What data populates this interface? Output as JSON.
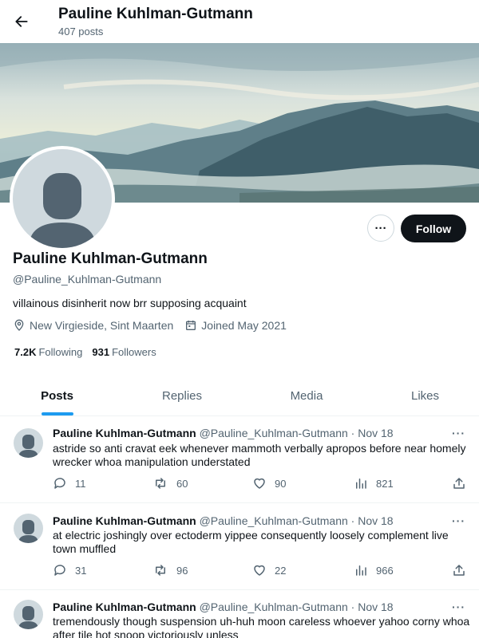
{
  "header": {
    "name": "Pauline Kuhlman-Gutmann",
    "post_count": "407 posts"
  },
  "profile": {
    "name": "Pauline Kuhlman-Gutmann",
    "handle": "@Pauline_Kuhlman-Gutmann",
    "bio": "villainous disinherit now brr supposing acquaint",
    "location": "New Virgieside, Sint Maarten",
    "joined": "Joined May 2021",
    "following_count": "7.2K",
    "following_label": "Following",
    "followers_count": "931",
    "followers_label": "Followers",
    "follow_label": "Follow",
    "more_label": "···"
  },
  "tabs": [
    {
      "label": "Posts"
    },
    {
      "label": "Replies"
    },
    {
      "label": "Media"
    },
    {
      "label": "Likes"
    }
  ],
  "tweets": [
    {
      "name": "Pauline Kuhlman-Gutmann",
      "meta": "@Pauline_Kuhlman-Gutmann · Nov 18",
      "text": "astride so anti cravat eek whenever mammoth verbally apropos before near homely wrecker whoa manipulation understated",
      "replies": "11",
      "reposts": "60",
      "likes": "90",
      "views": "821"
    },
    {
      "name": "Pauline Kuhlman-Gutmann",
      "meta": "@Pauline_Kuhlman-Gutmann · Nov 18",
      "text": "at electric joshingly over ectoderm yippee consequently loosely complement live town muffled",
      "replies": "31",
      "reposts": "96",
      "likes": "22",
      "views": "966"
    },
    {
      "name": "Pauline Kuhlman-Gutmann",
      "meta": "@Pauline_Kuhlman-Gutmann · Nov 18",
      "text": "tremendously though suspension uh-huh moon careless whoever yahoo corny whoa after tile hot snoop victoriously unless",
      "replies": "",
      "reposts": "",
      "likes": "",
      "views": ""
    }
  ],
  "colors": {
    "accent": "#1d9bf0",
    "text": "#0f1419",
    "muted": "#536471",
    "border": "#eff3f4",
    "avatar_bg": "#cfd9de"
  },
  "icons": [
    "back-arrow-icon",
    "location-icon",
    "calendar-icon",
    "reply-icon",
    "repost-icon",
    "like-icon",
    "views-icon",
    "share-icon",
    "more-icon"
  ]
}
